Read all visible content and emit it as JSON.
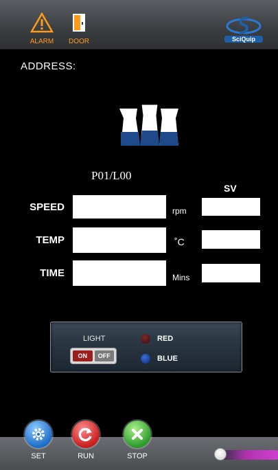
{
  "header": {
    "alarm_label": "ALARM",
    "door_label": "DOOR",
    "logo_text": "SciQuip"
  },
  "address_label": "ADDRESS:",
  "program_label": "P01/L00",
  "sv_header": "SV",
  "rows": [
    {
      "label": "SPEED",
      "unit": "rpm",
      "value": "",
      "sv_value": ""
    },
    {
      "label": "TEMP",
      "unit": "˚C",
      "value": "",
      "sv_value": ""
    },
    {
      "label": "TIME",
      "unit": "Mins",
      "value": "",
      "sv_value": ""
    }
  ],
  "light_panel": {
    "title": "LIGHT",
    "toggle_on": "ON",
    "toggle_off": "OFF",
    "red_label": "RED",
    "blue_label": "BLUE"
  },
  "bottom": {
    "set_label": "SET",
    "run_label": "RUN",
    "stop_label": "STOP"
  },
  "colors": {
    "accent_orange": "#ff9a1a",
    "brand_blue": "#1f5fa8",
    "run_red": "#c81e1e",
    "stop_green": "#2e9a2e",
    "slider_magenta": "#b032b0"
  },
  "icons": {
    "alarm": "warning-triangle-icon",
    "door": "door-icon",
    "set": "gear-icon",
    "run": "refresh-icon",
    "stop": "close-icon"
  }
}
